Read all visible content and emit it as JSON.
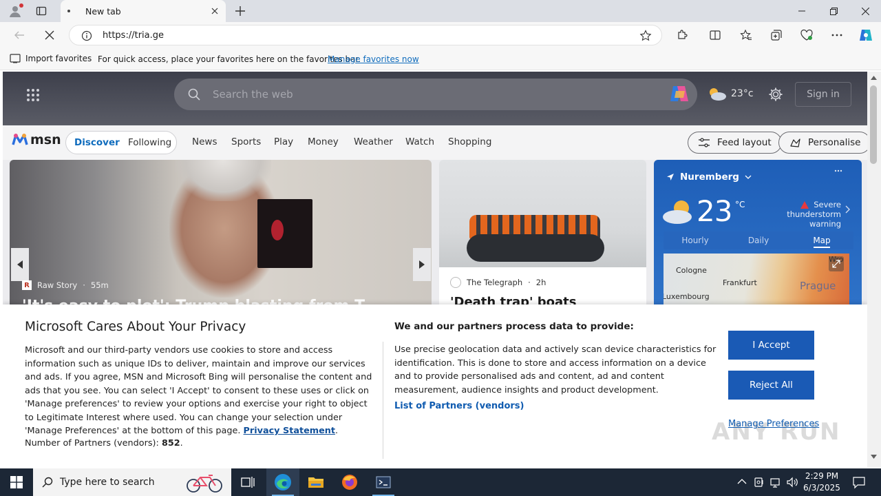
{
  "browser": {
    "tab_title": "New tab",
    "url": "https://tria.ge",
    "favorites_bar": {
      "import_label": "Import favorites",
      "message": "For quick access, place your favorites here on the favorites bar.",
      "manage_link": "Manage favorites now"
    }
  },
  "msn": {
    "search_placeholder": "Search the web",
    "weather_temp": "23°c",
    "sign_in": "Sign in",
    "logo_text": "msn",
    "nav": {
      "discover": "Discover",
      "following": "Following",
      "links": [
        "News",
        "Sports",
        "Play",
        "Money",
        "Weather",
        "Watch",
        "Shopping"
      ],
      "feed_layout": "Feed layout",
      "personalise": "Personalise"
    },
    "card1": {
      "source": "Raw Story",
      "age": "55m",
      "headline": "'It's easy to plot': Trump blasting from T..."
    },
    "card2": {
      "source": "The Telegraph",
      "age": "2h",
      "headline": "'Death trap' boats"
    },
    "weather_card": {
      "city": "Nuremberg",
      "temp": "23",
      "unit": "°C",
      "warning": "Severe thunderstorm warning",
      "tabs": [
        "Hourly",
        "Daily",
        "Map"
      ],
      "active_tab": "Map",
      "map_labels": [
        "Cologne",
        "Frankfurt",
        "Prague",
        "Luxembourg",
        "Wro"
      ]
    }
  },
  "privacy": {
    "title": "Microsoft Cares About Your Privacy",
    "body": "Microsoft and our third-party vendors use cookies to store and access information such as unique IDs to deliver, maintain and improve our services and ads. If you agree, MSN and Microsoft Bing will personalise the content and ads that you see. You can select 'I Accept' to consent to these uses or click on 'Manage preferences' to review your options and exercise your right to object to Legitimate Interest where used.  You can change your selection under 'Manage Preferences' at the bottom of this page.",
    "privacy_link": "Privacy Statement",
    "partners_label": "Number of Partners (vendors):",
    "partners_count": "852",
    "process_title": "We and our partners process data to provide:",
    "process_body": "Use precise geolocation data and actively scan device characteristics for identification. This is done to store and access information on a device and to provide personalised ads and content, ad and content measurement, audience insights and product development.",
    "list_partners": "List of Partners (vendors)",
    "accept": "I Accept",
    "reject": "Reject All",
    "manage": "Manage Preferences"
  },
  "watermark": "ANY RUN",
  "taskbar": {
    "search_placeholder": "Type here to search",
    "time": "2:29 PM",
    "date": "6/3/2025"
  },
  "colors": {
    "accent_blue": "#1a5ab5",
    "link_blue": "#0f6cbd",
    "taskbar": "#1c2736",
    "weather_card": "#2f73c9"
  }
}
